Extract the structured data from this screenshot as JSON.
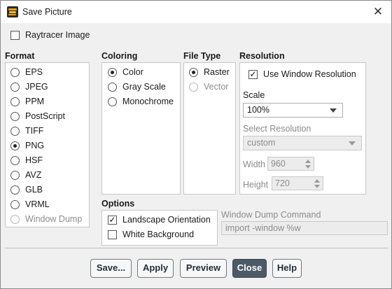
{
  "window": {
    "title": "Save Picture",
    "close_glyph": "✕"
  },
  "raytracer": {
    "label": "Raytracer Image",
    "checked": false
  },
  "format": {
    "title": "Format",
    "options": [
      {
        "label": "EPS",
        "selected": false,
        "enabled": true
      },
      {
        "label": "JPEG",
        "selected": false,
        "enabled": true
      },
      {
        "label": "PPM",
        "selected": false,
        "enabled": true
      },
      {
        "label": "PostScript",
        "selected": false,
        "enabled": true
      },
      {
        "label": "TIFF",
        "selected": false,
        "enabled": true
      },
      {
        "label": "PNG",
        "selected": true,
        "enabled": true
      },
      {
        "label": "HSF",
        "selected": false,
        "enabled": true
      },
      {
        "label": "AVZ",
        "selected": false,
        "enabled": true
      },
      {
        "label": "GLB",
        "selected": false,
        "enabled": true
      },
      {
        "label": "VRML",
        "selected": false,
        "enabled": true
      },
      {
        "label": "Window Dump",
        "selected": false,
        "enabled": false
      }
    ]
  },
  "coloring": {
    "title": "Coloring",
    "options": [
      {
        "label": "Color",
        "selected": true
      },
      {
        "label": "Gray Scale",
        "selected": false
      },
      {
        "label": "Monochrome",
        "selected": false
      }
    ]
  },
  "file_type": {
    "title": "File Type",
    "options": [
      {
        "label": "Raster",
        "selected": true,
        "enabled": true
      },
      {
        "label": "Vector",
        "selected": false,
        "enabled": false
      }
    ]
  },
  "resolution": {
    "title": "Resolution",
    "use_window_label": "Use Window Resolution",
    "use_window_checked": true,
    "scale_label": "Scale",
    "scale_value": "100%",
    "select_label": "Select Resolution",
    "select_value": "custom",
    "width_label": "Width",
    "width_value": "960",
    "height_label": "Height",
    "height_value": "720"
  },
  "options": {
    "title": "Options",
    "landscape_label": "Landscape Orientation",
    "landscape_checked": true,
    "white_bg_label": "White Background",
    "white_bg_checked": false
  },
  "window_dump": {
    "label": "Window Dump Command",
    "value": "import -window %w"
  },
  "buttons": {
    "save": "Save...",
    "apply": "Apply",
    "preview": "Preview",
    "close": "Close",
    "help": "Help"
  },
  "colors": {
    "primary_button": "#4d5a66",
    "group_border": "#c7c7c7"
  }
}
